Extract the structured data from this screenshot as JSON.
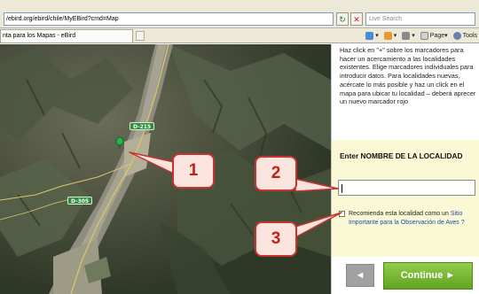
{
  "browser": {
    "address": "/ebird.org/ebird/chile/MyEBird?cmd=Map",
    "search_placeholder": "Live Search",
    "tab_title": "nta para los Mapas - eBird",
    "toolbar_page": "Page",
    "toolbar_tools": "Tools"
  },
  "map": {
    "road_labels": [
      "D-215",
      "D-305"
    ]
  },
  "panel": {
    "instructions": "Haz click en \"+\" sobre los marcadores para hacer un acercamiento a las localidades existentes. Elige marcadores individuales para introducir datos. Para localidades nuevas, acércate lo más posible y haz un click en el mapa para ubicar tu localidad – deberá aprecer un nuevo marcador rojo",
    "enter_label": "Enter NOMBRE DE LA LOCALIDAD",
    "name_value": "",
    "checkbox_text": "Recomienda esta localidad como un",
    "checkbox_link": "Sitio Importante para la Observación de Aves",
    "checkbox_suffix": " ?",
    "back_label": "◄",
    "continue_label": "Continue ►"
  },
  "callouts": [
    "1",
    "2",
    "3"
  ],
  "colors": {
    "callout_border": "#c83230",
    "callout_fill": "#fbe4dd",
    "continue_green": "#63a221",
    "panel_yellow": "#fbf8d6",
    "link_blue": "#1b4fa3"
  }
}
